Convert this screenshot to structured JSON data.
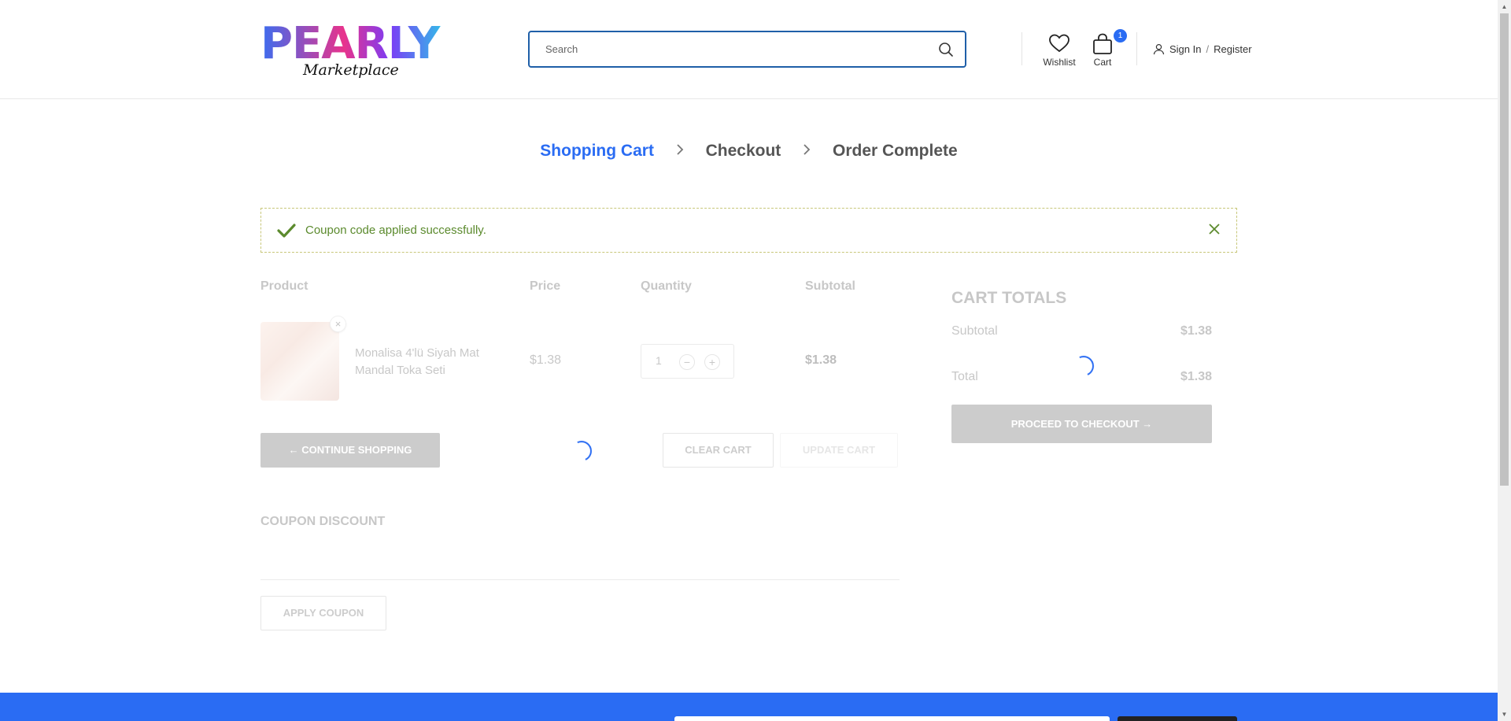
{
  "header": {
    "logo_text": "PEARLY",
    "logo_tag": "Marketplace",
    "search_placeholder": "Search",
    "wishlist_label": "Wishlist",
    "cart_label": "Cart",
    "cart_count": "1",
    "signin_label": "Sign In",
    "separator": "/",
    "register_label": "Register"
  },
  "steps": {
    "step1": "Shopping Cart",
    "step2": "Checkout",
    "step3": "Order Complete"
  },
  "notice": {
    "message": "Coupon code applied successfully."
  },
  "table": {
    "col_product": "Product",
    "col_price": "Price",
    "col_quantity": "Quantity",
    "col_subtotal": "Subtotal"
  },
  "item": {
    "remove": "×",
    "name": "Monalisa 4'lü Siyah Mat Mandal Toka Seti",
    "price": "$1.38",
    "quantity": "1",
    "minus": "−",
    "plus": "+",
    "subtotal": "$1.38"
  },
  "actions": {
    "continue_shopping": "CONTINUE SHOPPING",
    "clear_cart": "CLEAR CART",
    "update_cart": "UPDATE CART"
  },
  "coupon": {
    "title": "COUPON DISCOUNT",
    "apply": "APPLY COUPON"
  },
  "totals": {
    "title": "CART TOTALS",
    "subtotal_label": "Subtotal",
    "subtotal_value": "$1.38",
    "total_label": "Total",
    "total_value": "$1.38",
    "checkout": "PROCEED TO CHECKOUT"
  },
  "colors": {
    "accent": "#2a6cf3",
    "success": "#5b8a2d"
  }
}
